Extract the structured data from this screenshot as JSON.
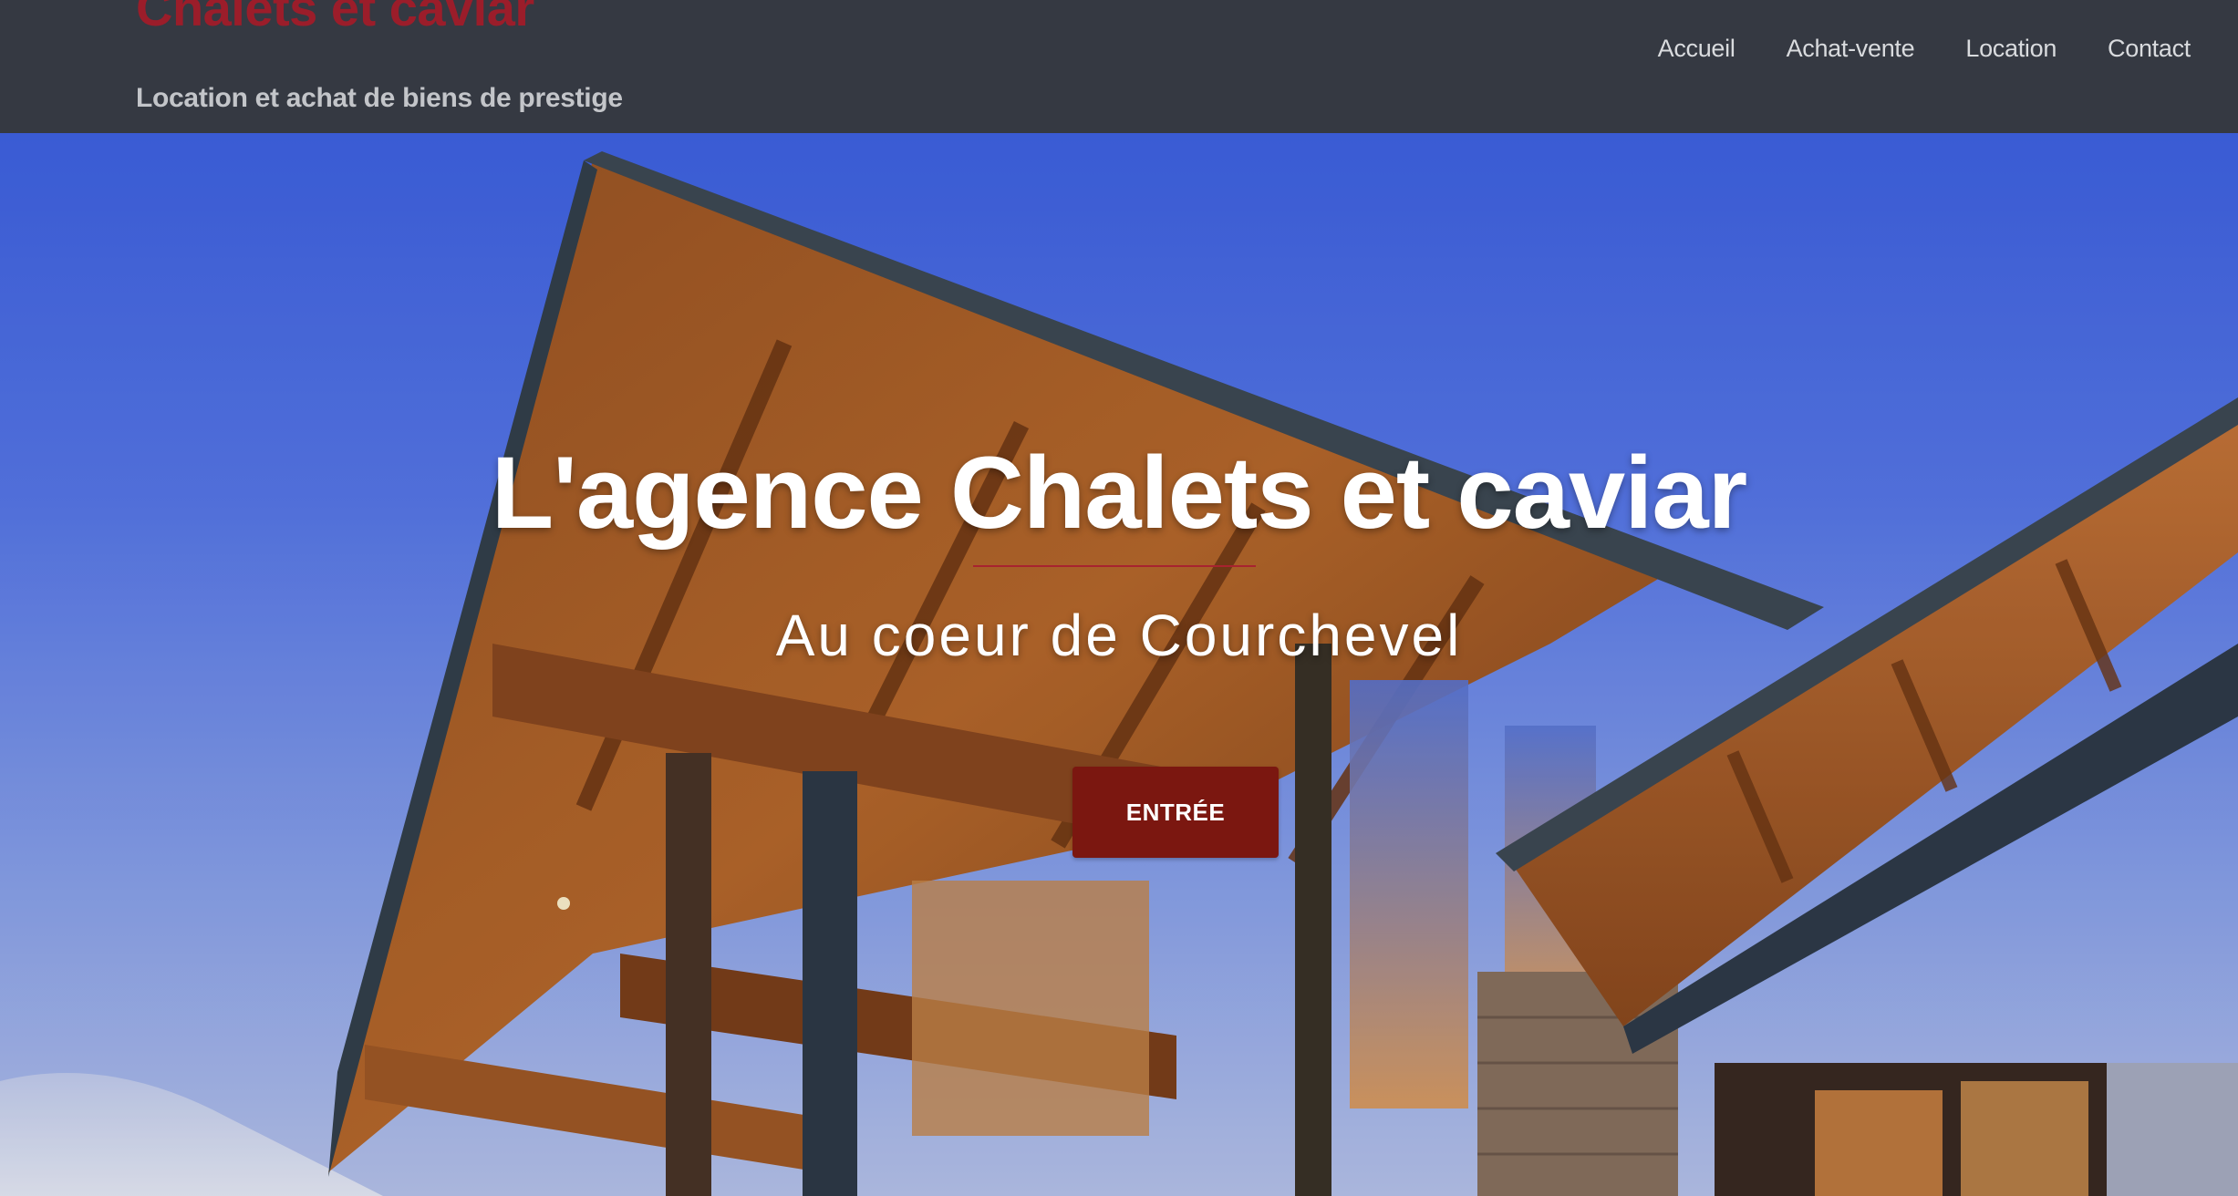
{
  "header": {
    "site_title": "Chalets et caviar",
    "tagline": "Location et achat de biens de prestige",
    "nav": [
      {
        "label": "Accueil"
      },
      {
        "label": "Achat-vente"
      },
      {
        "label": "Location"
      },
      {
        "label": "Contact"
      }
    ]
  },
  "hero": {
    "title": "L'agence Chalets et caviar",
    "subtitle": "Au coeur de Courchevel",
    "button_label": "ENTRÉE",
    "background_image": "chalet-photo"
  },
  "colors": {
    "header_bg": "#353942",
    "brand": "#9b1d2a",
    "button": "#7b1710",
    "divider": "#a8232f"
  }
}
